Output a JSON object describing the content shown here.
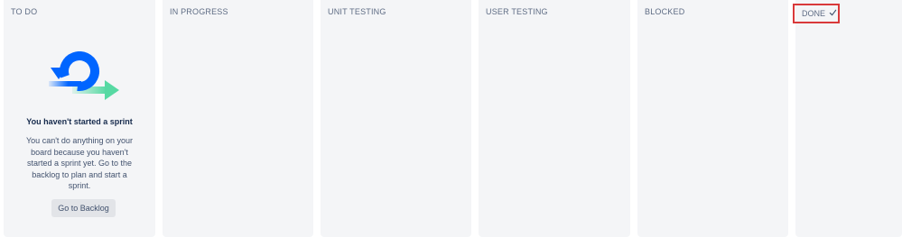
{
  "board": {
    "columns": [
      {
        "title": "TO DO"
      },
      {
        "title": "IN PROGRESS"
      },
      {
        "title": "UNIT TESTING"
      },
      {
        "title": "USER TESTING"
      },
      {
        "title": "BLOCKED"
      },
      {
        "title": "DONE"
      }
    ],
    "done_icon": "check-icon"
  },
  "empty_state": {
    "illustration": "sprint-cycle-icon",
    "title": "You haven't started a sprint",
    "body": "You can't do anything on your board because you haven't started a sprint yet. Go to the backlog to plan and start a sprint.",
    "button_label": "Go to Backlog"
  },
  "colors": {
    "column_bg": "#f4f5f7",
    "highlight_border": "#d9393a",
    "illustration_blue": "#0065ff",
    "illustration_green": "#57d9a3"
  }
}
